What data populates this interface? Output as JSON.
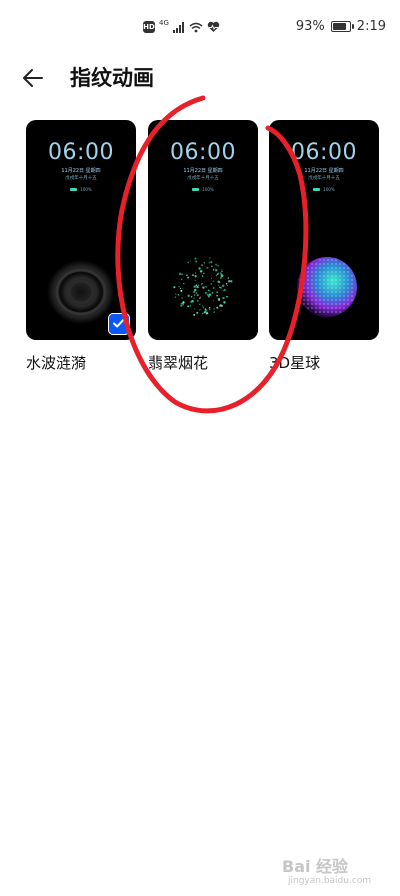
{
  "status_bar": {
    "hd_label": "HD",
    "network_label": "4G",
    "battery_text": "93%",
    "battery_level": 0.93,
    "time": "2:19"
  },
  "header": {
    "title": "指纹动画"
  },
  "cards": [
    {
      "label": "水波涟漪",
      "time": "06:00",
      "date": "11月22日 星期四",
      "lunar": "戊戌年十月十五",
      "battery": "100%",
      "selected": true
    },
    {
      "label": "翡翠烟花",
      "time": "06:00",
      "date": "11月22日 星期四",
      "lunar": "戊戌年十月十五",
      "battery": "100%",
      "selected": false
    },
    {
      "label": "3D星球",
      "time": "06:00",
      "date": "11月22日 星期四",
      "lunar": "戊戌年十月十五",
      "battery": "100%",
      "selected": false
    }
  ],
  "watermark": {
    "text": "Bai 经验",
    "sub": "jingyan.baidu.com"
  },
  "colors": {
    "accent": "#0a59f7",
    "clock_text": "#9fd4ea",
    "annotation": "#e8202a"
  }
}
